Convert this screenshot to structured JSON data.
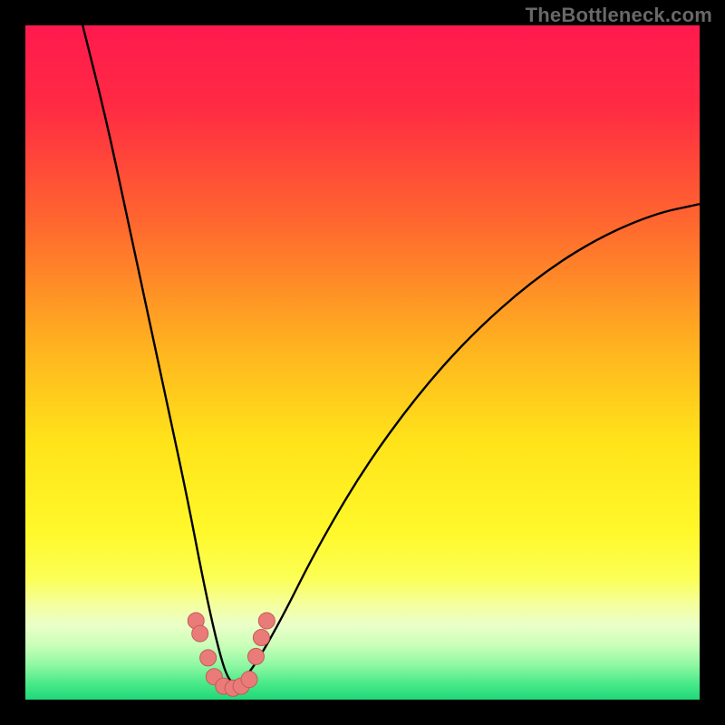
{
  "watermark": "TheBottleneck.com",
  "colors": {
    "gradient_stops": [
      {
        "offset": 0.0,
        "color": "#ff1a4e"
      },
      {
        "offset": 0.12,
        "color": "#ff2a43"
      },
      {
        "offset": 0.3,
        "color": "#ff6a2e"
      },
      {
        "offset": 0.48,
        "color": "#ffb41f"
      },
      {
        "offset": 0.62,
        "color": "#ffe41a"
      },
      {
        "offset": 0.75,
        "color": "#fff82a"
      },
      {
        "offset": 0.82,
        "color": "#fcff55"
      },
      {
        "offset": 0.86,
        "color": "#f4ffa0"
      },
      {
        "offset": 0.89,
        "color": "#eaffc8"
      },
      {
        "offset": 0.92,
        "color": "#c9ffb8"
      },
      {
        "offset": 0.95,
        "color": "#8cf7a2"
      },
      {
        "offset": 0.975,
        "color": "#4cea8a"
      },
      {
        "offset": 1.0,
        "color": "#1fd879"
      }
    ],
    "curve": "#000000",
    "marker_fill": "#e97c79",
    "marker_stroke": "#c55a57",
    "background": "#000000"
  },
  "chart_data": {
    "type": "line",
    "title": "",
    "xlabel": "",
    "ylabel": "",
    "xlim": [
      0,
      1
    ],
    "ylim": [
      0,
      1
    ],
    "notes": "Background encodes a vertical red→yellow→green gradient (top=1 red, bottom=0 green). Two black curves descending into a shared minimum near x≈0.30, y≈0.02. x/y in normalized plot coordinates; no axis ticks or labels visible.",
    "series": [
      {
        "name": "left-curve",
        "x": [
          0.085,
          0.12,
          0.15,
          0.18,
          0.21,
          0.24,
          0.265,
          0.285,
          0.3,
          0.315
        ],
        "values": [
          1.0,
          0.86,
          0.72,
          0.58,
          0.44,
          0.3,
          0.17,
          0.08,
          0.03,
          0.02
        ]
      },
      {
        "name": "right-curve",
        "x": [
          0.315,
          0.34,
          0.38,
          0.43,
          0.5,
          0.58,
          0.66,
          0.75,
          0.84,
          0.93,
          1.0
        ],
        "values": [
          0.02,
          0.05,
          0.12,
          0.22,
          0.34,
          0.45,
          0.54,
          0.62,
          0.68,
          0.72,
          0.735
        ]
      }
    ],
    "markers": [
      {
        "x": 0.253,
        "y": 0.117
      },
      {
        "x": 0.259,
        "y": 0.098
      },
      {
        "x": 0.271,
        "y": 0.062
      },
      {
        "x": 0.28,
        "y": 0.034
      },
      {
        "x": 0.294,
        "y": 0.02
      },
      {
        "x": 0.308,
        "y": 0.017
      },
      {
        "x": 0.32,
        "y": 0.02
      },
      {
        "x": 0.332,
        "y": 0.03
      },
      {
        "x": 0.342,
        "y": 0.064
      },
      {
        "x": 0.35,
        "y": 0.092
      },
      {
        "x": 0.358,
        "y": 0.117
      }
    ]
  }
}
